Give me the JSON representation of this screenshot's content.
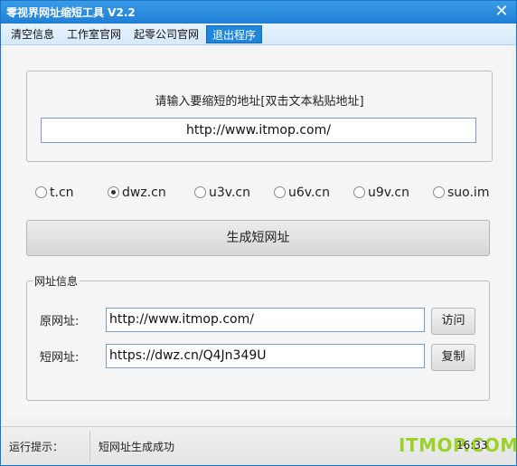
{
  "window": {
    "title": "零视界网址缩短工具 V2.2",
    "close_glyph": "✕"
  },
  "menu": {
    "items": [
      {
        "label": "清空信息"
      },
      {
        "label": "工作室官网"
      },
      {
        "label": "起零公司官网"
      },
      {
        "label": "退出程序",
        "active": true
      }
    ]
  },
  "input_section": {
    "prompt": "请输入要缩短的地址[双击文本粘贴地址]",
    "url_value": "http://www.itmop.com/"
  },
  "services": {
    "options": [
      "t.cn",
      "dwz.cn",
      "u3v.cn",
      "u6v.cn",
      "u9v.cn",
      "suo.im"
    ],
    "selected": "dwz.cn"
  },
  "generate_button": "生成短网址",
  "url_info": {
    "title": "网址信息",
    "original_label": "原网址:",
    "original_value": "http://www.itmop.com/",
    "visit_button": "访问",
    "short_label": "短网址:",
    "short_value": "https://dwz.cn/Q4Jn349U",
    "copy_button": "复制"
  },
  "status": {
    "label": "运行提示：",
    "message": "短网址生成成功",
    "time": "16:33",
    "watermark": "ITMOP.COM"
  },
  "colors": {
    "title_bar": "#1e7fd6",
    "active_menu": "#1f86dc",
    "watermark": "#9bd22a"
  }
}
